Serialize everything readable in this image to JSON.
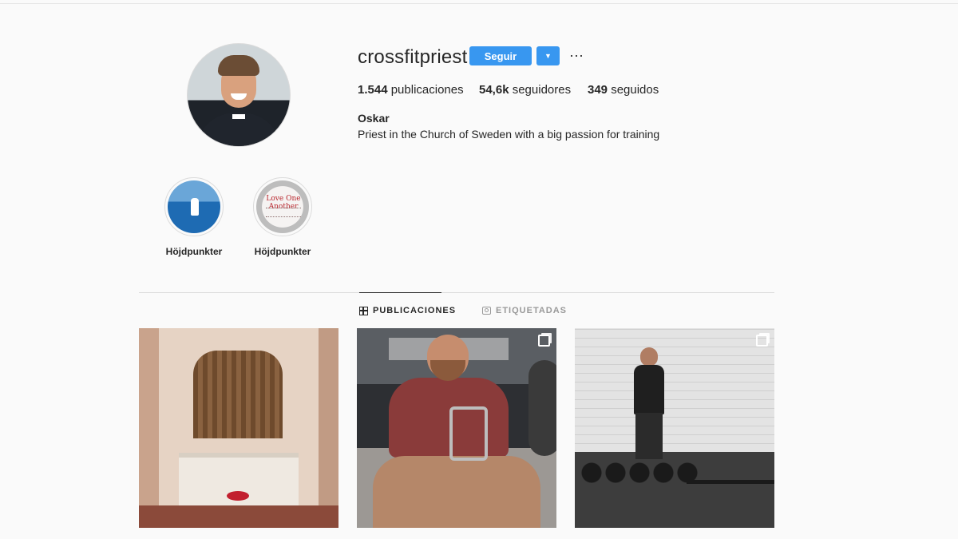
{
  "profile": {
    "username": "crossfitpriest",
    "follow_label": "Seguir",
    "dropdown_label": "▼",
    "more_label": "···",
    "stats": {
      "posts_count": "1.544",
      "posts_label": " publicaciones",
      "followers_count": "54,6k",
      "followers_label": " seguidores",
      "following_count": "349",
      "following_label": " seguidos"
    },
    "full_name": "Oskar",
    "bio": "Priest in the Church of Sweden with a big passion for training"
  },
  "highlights": [
    {
      "label": "Höjdpunkter"
    },
    {
      "label": "Höjdpunkter",
      "cover_text": "Love One Another"
    }
  ],
  "tabs": [
    {
      "label": "PUBLICACIONES",
      "icon": "grid-icon",
      "active": true
    },
    {
      "label": "ETIQUETADAS",
      "icon": "tag-icon",
      "active": false
    }
  ],
  "posts": [
    {
      "subject": "church altar",
      "multi": false
    },
    {
      "subject": "man rowing at gym",
      "multi": true
    },
    {
      "subject": "man standing in gym",
      "multi": true
    }
  ],
  "colors": {
    "accent": "#3897f0",
    "background": "#fafafa",
    "text": "#262626",
    "muted": "#999999"
  }
}
